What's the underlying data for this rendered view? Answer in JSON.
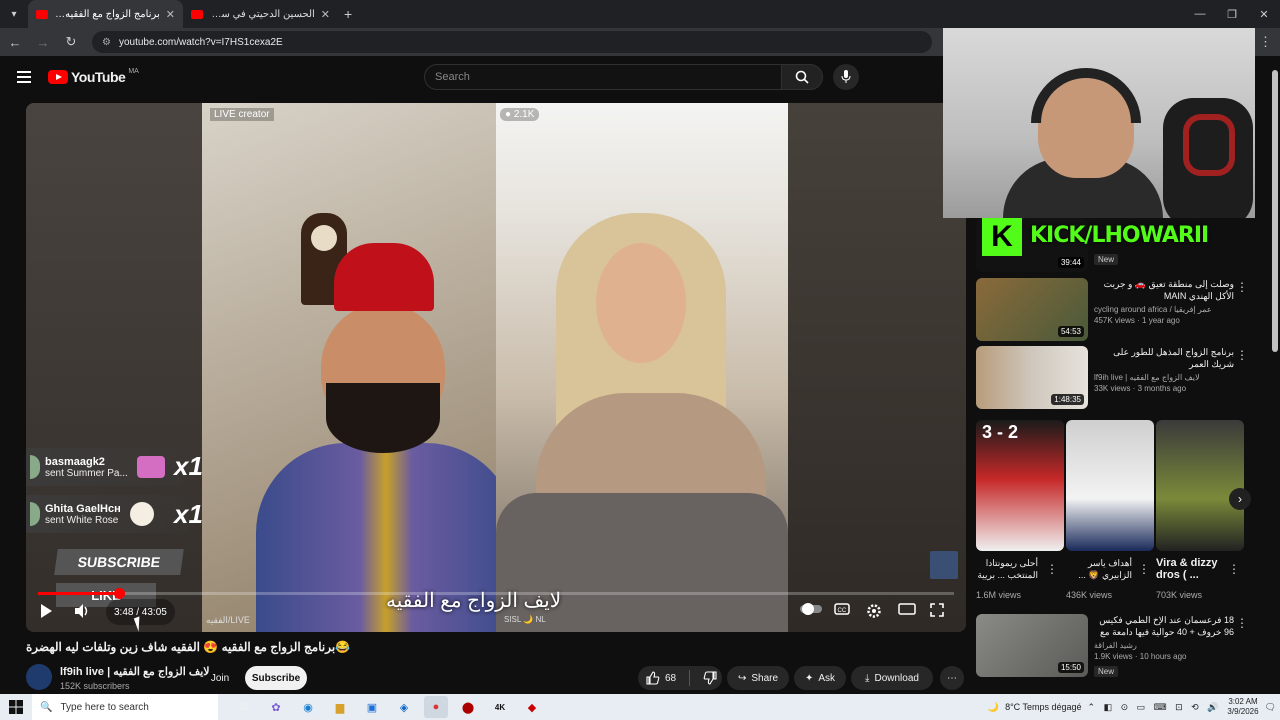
{
  "browser": {
    "tabs": [
      {
        "title": "برنامج الزواج مع الفقيه 😍 الفقيه",
        "active": true
      },
      {
        "title": "الحسين الدحيتي في ساعة في الـ",
        "active": false
      }
    ],
    "url": "youtube.com/watch?v=I7HS1cexa2E"
  },
  "yt": {
    "logo": "YouTube",
    "region": "MA",
    "search_placeholder": "Search"
  },
  "player": {
    "live_creator": "LIVE creator",
    "viewers": "2.1K",
    "gifts": [
      {
        "user": "basmaagk2",
        "text": "sent Summer Pa...",
        "count": "x1"
      },
      {
        "user": "Ghita GaelHcн",
        "text": "sent White Rose",
        "count": "x1"
      }
    ],
    "subscribe_sign": "SUBSCRIBE",
    "like_sign": "LIKE",
    "caption": "لايف الزواج مع الفقيه",
    "watermark_left": "الفقيه/LIVE",
    "watermark_right": "SISL 🌙 NL",
    "time": "3:48 / 43:05",
    "progress_fraction": 0.088
  },
  "video": {
    "title": "😂برنامج الزواج مع الفقيه 😍 الفقيه شاف زين وتلفات ليه الهضرة",
    "channel": "lf9ih live | لايف الزواج مع الفقيه",
    "subscribers": "152K subscribers",
    "join": "Join",
    "subscribe": "Subscribe",
    "likes": "68",
    "share": "Share",
    "ask": "Ask",
    "download": "Download"
  },
  "sidebar": {
    "kick": {
      "banner": "KICK/LHOWARII",
      "duration": "39:44",
      "badge": "New"
    },
    "items": [
      {
        "title": "وصلت إلى منطقة تعيق 🚗 و جربت الأكل الهندي MAIN",
        "channel": "cycling around africa / عمر إفريقيا",
        "views": "457K views · 1 year ago",
        "duration": "54:53",
        "color": "#5a6a3a"
      },
      {
        "title": "برنامج الزواج المذهل للطور على شريك العمر",
        "channel": "lf9ih live | لايف الزواج مع الفقيه",
        "views": "33K views · 3 months ago",
        "duration": "1:48:35",
        "color": "#7a6a5a"
      }
    ],
    "shorts": [
      {
        "title": "أحلى ريمونتادا المنتخب ... بريية",
        "views": "1.6M views",
        "color": "#c02020",
        "overlay": "3 - 2"
      },
      {
        "title": "أهداف ياسر الزابيري 🦁 ...",
        "views": "436K views",
        "color": "#e6e6e6"
      },
      {
        "title": "Vira & dizzy dros ( ...",
        "views": "703K views",
        "color": "#2a2a2a"
      }
    ],
    "item3": {
      "title": "18 فرعسمان عند الإخ الطمي فكيس 96 خروف + 40 حوالية فيها دامعة مع ذكر اللفتن",
      "channel": "رشيد الفراقة",
      "views": "1.9K views · 10 hours ago",
      "duration": "15:50",
      "badge": "New"
    }
  },
  "taskbar": {
    "search_placeholder": "Type here to search",
    "weather": "8°C  Temps dégagé",
    "time": "3:02 AM",
    "date": "3/9/2026"
  }
}
